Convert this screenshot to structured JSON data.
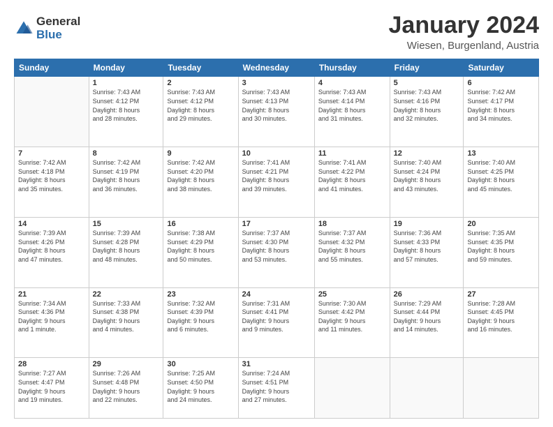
{
  "logo": {
    "general": "General",
    "blue": "Blue"
  },
  "title": "January 2024",
  "location": "Wiesen, Burgenland, Austria",
  "weekdays": [
    "Sunday",
    "Monday",
    "Tuesday",
    "Wednesday",
    "Thursday",
    "Friday",
    "Saturday"
  ],
  "weeks": [
    [
      {
        "day": "",
        "detail": ""
      },
      {
        "day": "1",
        "detail": "Sunrise: 7:43 AM\nSunset: 4:12 PM\nDaylight: 8 hours\nand 28 minutes."
      },
      {
        "day": "2",
        "detail": "Sunrise: 7:43 AM\nSunset: 4:12 PM\nDaylight: 8 hours\nand 29 minutes."
      },
      {
        "day": "3",
        "detail": "Sunrise: 7:43 AM\nSunset: 4:13 PM\nDaylight: 8 hours\nand 30 minutes."
      },
      {
        "day": "4",
        "detail": "Sunrise: 7:43 AM\nSunset: 4:14 PM\nDaylight: 8 hours\nand 31 minutes."
      },
      {
        "day": "5",
        "detail": "Sunrise: 7:43 AM\nSunset: 4:16 PM\nDaylight: 8 hours\nand 32 minutes."
      },
      {
        "day": "6",
        "detail": "Sunrise: 7:42 AM\nSunset: 4:17 PM\nDaylight: 8 hours\nand 34 minutes."
      }
    ],
    [
      {
        "day": "7",
        "detail": "Sunrise: 7:42 AM\nSunset: 4:18 PM\nDaylight: 8 hours\nand 35 minutes."
      },
      {
        "day": "8",
        "detail": "Sunrise: 7:42 AM\nSunset: 4:19 PM\nDaylight: 8 hours\nand 36 minutes."
      },
      {
        "day": "9",
        "detail": "Sunrise: 7:42 AM\nSunset: 4:20 PM\nDaylight: 8 hours\nand 38 minutes."
      },
      {
        "day": "10",
        "detail": "Sunrise: 7:41 AM\nSunset: 4:21 PM\nDaylight: 8 hours\nand 39 minutes."
      },
      {
        "day": "11",
        "detail": "Sunrise: 7:41 AM\nSunset: 4:22 PM\nDaylight: 8 hours\nand 41 minutes."
      },
      {
        "day": "12",
        "detail": "Sunrise: 7:40 AM\nSunset: 4:24 PM\nDaylight: 8 hours\nand 43 minutes."
      },
      {
        "day": "13",
        "detail": "Sunrise: 7:40 AM\nSunset: 4:25 PM\nDaylight: 8 hours\nand 45 minutes."
      }
    ],
    [
      {
        "day": "14",
        "detail": "Sunrise: 7:39 AM\nSunset: 4:26 PM\nDaylight: 8 hours\nand 47 minutes."
      },
      {
        "day": "15",
        "detail": "Sunrise: 7:39 AM\nSunset: 4:28 PM\nDaylight: 8 hours\nand 48 minutes."
      },
      {
        "day": "16",
        "detail": "Sunrise: 7:38 AM\nSunset: 4:29 PM\nDaylight: 8 hours\nand 50 minutes."
      },
      {
        "day": "17",
        "detail": "Sunrise: 7:37 AM\nSunset: 4:30 PM\nDaylight: 8 hours\nand 53 minutes."
      },
      {
        "day": "18",
        "detail": "Sunrise: 7:37 AM\nSunset: 4:32 PM\nDaylight: 8 hours\nand 55 minutes."
      },
      {
        "day": "19",
        "detail": "Sunrise: 7:36 AM\nSunset: 4:33 PM\nDaylight: 8 hours\nand 57 minutes."
      },
      {
        "day": "20",
        "detail": "Sunrise: 7:35 AM\nSunset: 4:35 PM\nDaylight: 8 hours\nand 59 minutes."
      }
    ],
    [
      {
        "day": "21",
        "detail": "Sunrise: 7:34 AM\nSunset: 4:36 PM\nDaylight: 9 hours\nand 1 minute."
      },
      {
        "day": "22",
        "detail": "Sunrise: 7:33 AM\nSunset: 4:38 PM\nDaylight: 9 hours\nand 4 minutes."
      },
      {
        "day": "23",
        "detail": "Sunrise: 7:32 AM\nSunset: 4:39 PM\nDaylight: 9 hours\nand 6 minutes."
      },
      {
        "day": "24",
        "detail": "Sunrise: 7:31 AM\nSunset: 4:41 PM\nDaylight: 9 hours\nand 9 minutes."
      },
      {
        "day": "25",
        "detail": "Sunrise: 7:30 AM\nSunset: 4:42 PM\nDaylight: 9 hours\nand 11 minutes."
      },
      {
        "day": "26",
        "detail": "Sunrise: 7:29 AM\nSunset: 4:44 PM\nDaylight: 9 hours\nand 14 minutes."
      },
      {
        "day": "27",
        "detail": "Sunrise: 7:28 AM\nSunset: 4:45 PM\nDaylight: 9 hours\nand 16 minutes."
      }
    ],
    [
      {
        "day": "28",
        "detail": "Sunrise: 7:27 AM\nSunset: 4:47 PM\nDaylight: 9 hours\nand 19 minutes."
      },
      {
        "day": "29",
        "detail": "Sunrise: 7:26 AM\nSunset: 4:48 PM\nDaylight: 9 hours\nand 22 minutes."
      },
      {
        "day": "30",
        "detail": "Sunrise: 7:25 AM\nSunset: 4:50 PM\nDaylight: 9 hours\nand 24 minutes."
      },
      {
        "day": "31",
        "detail": "Sunrise: 7:24 AM\nSunset: 4:51 PM\nDaylight: 9 hours\nand 27 minutes."
      },
      {
        "day": "",
        "detail": ""
      },
      {
        "day": "",
        "detail": ""
      },
      {
        "day": "",
        "detail": ""
      }
    ]
  ]
}
